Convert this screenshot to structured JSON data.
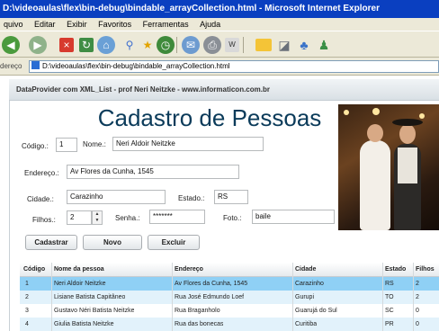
{
  "window": {
    "title": "D:\\videoaulas\\flex\\bin-debug\\bindable_arrayCollection.html - Microsoft Internet Explorer"
  },
  "menu": [
    "quivo",
    "Editar",
    "Exibir",
    "Favoritos",
    "Ferramentas",
    "Ajuda"
  ],
  "toolbar_icons": [
    "back-icon",
    "forward-icon",
    "stop-icon",
    "refresh-icon",
    "home-icon",
    "search-icon",
    "favorites-icon",
    "history-icon",
    "mail-icon",
    "print-icon",
    "edit-icon",
    "folder-icon",
    "chart-icon",
    "msn-icon",
    "messenger-icon"
  ],
  "address": {
    "label": "dereço",
    "url": "D:\\videoaulas\\flex\\bin-debug\\bindable_arrayCollection.html"
  },
  "panel": {
    "title": "DataProvider com XML_List - prof Neri Neitzke - www.informaticon.com.br"
  },
  "form": {
    "heading": "Cadastro de Pessoas",
    "codigo_label": "Código.:",
    "codigo_value": "1",
    "nome_label": "Nome.:",
    "nome_value": "Neri Aldoir Neitzke",
    "endereco_label": "Endereço.:",
    "endereco_value": "Av Flores da Cunha, 1545",
    "cidade_label": "Cidade.:",
    "cidade_value": "Carazinho",
    "estado_label": "Estado.:",
    "estado_value": "RS",
    "filhos_label": "Filhos.:",
    "filhos_value": "2",
    "senha_label": "Senha.:",
    "senha_value": "*******",
    "foto_label": "Foto.:",
    "foto_value": "baile"
  },
  "buttons": {
    "cadastrar": "Cadastrar",
    "novo": "Novo",
    "excluir": "Excluir"
  },
  "grid": {
    "columns": [
      "Código",
      "Nome da pessoa",
      "Endereço",
      "Cidade",
      "Estado",
      "Filhos"
    ],
    "rows": [
      [
        "1",
        "Neri Aldoir Neitzke",
        "Av Flores da Cunha, 1545",
        "Carazinho",
        "RS",
        "2"
      ],
      [
        "2",
        "Lisiane Batista Capitâneo",
        "Rua José Edmundo Loef",
        "Gurupi",
        "TO",
        "2"
      ],
      [
        "3",
        "Gustavo Néri Batista Neitzke",
        "Rua Braganholo",
        "Guarujá do Sul",
        "SC",
        "0"
      ],
      [
        "4",
        "Giulia Batista Neitzke",
        "Rua das bonecas",
        "Curitiba",
        "PR",
        "0"
      ]
    ],
    "selected_row": 0
  },
  "colors": {
    "title_bar": "#0a3fc0",
    "heading": "#0b3b5a",
    "selected_row": "#8fd0f5",
    "hover_row": "#e2f2fb"
  }
}
